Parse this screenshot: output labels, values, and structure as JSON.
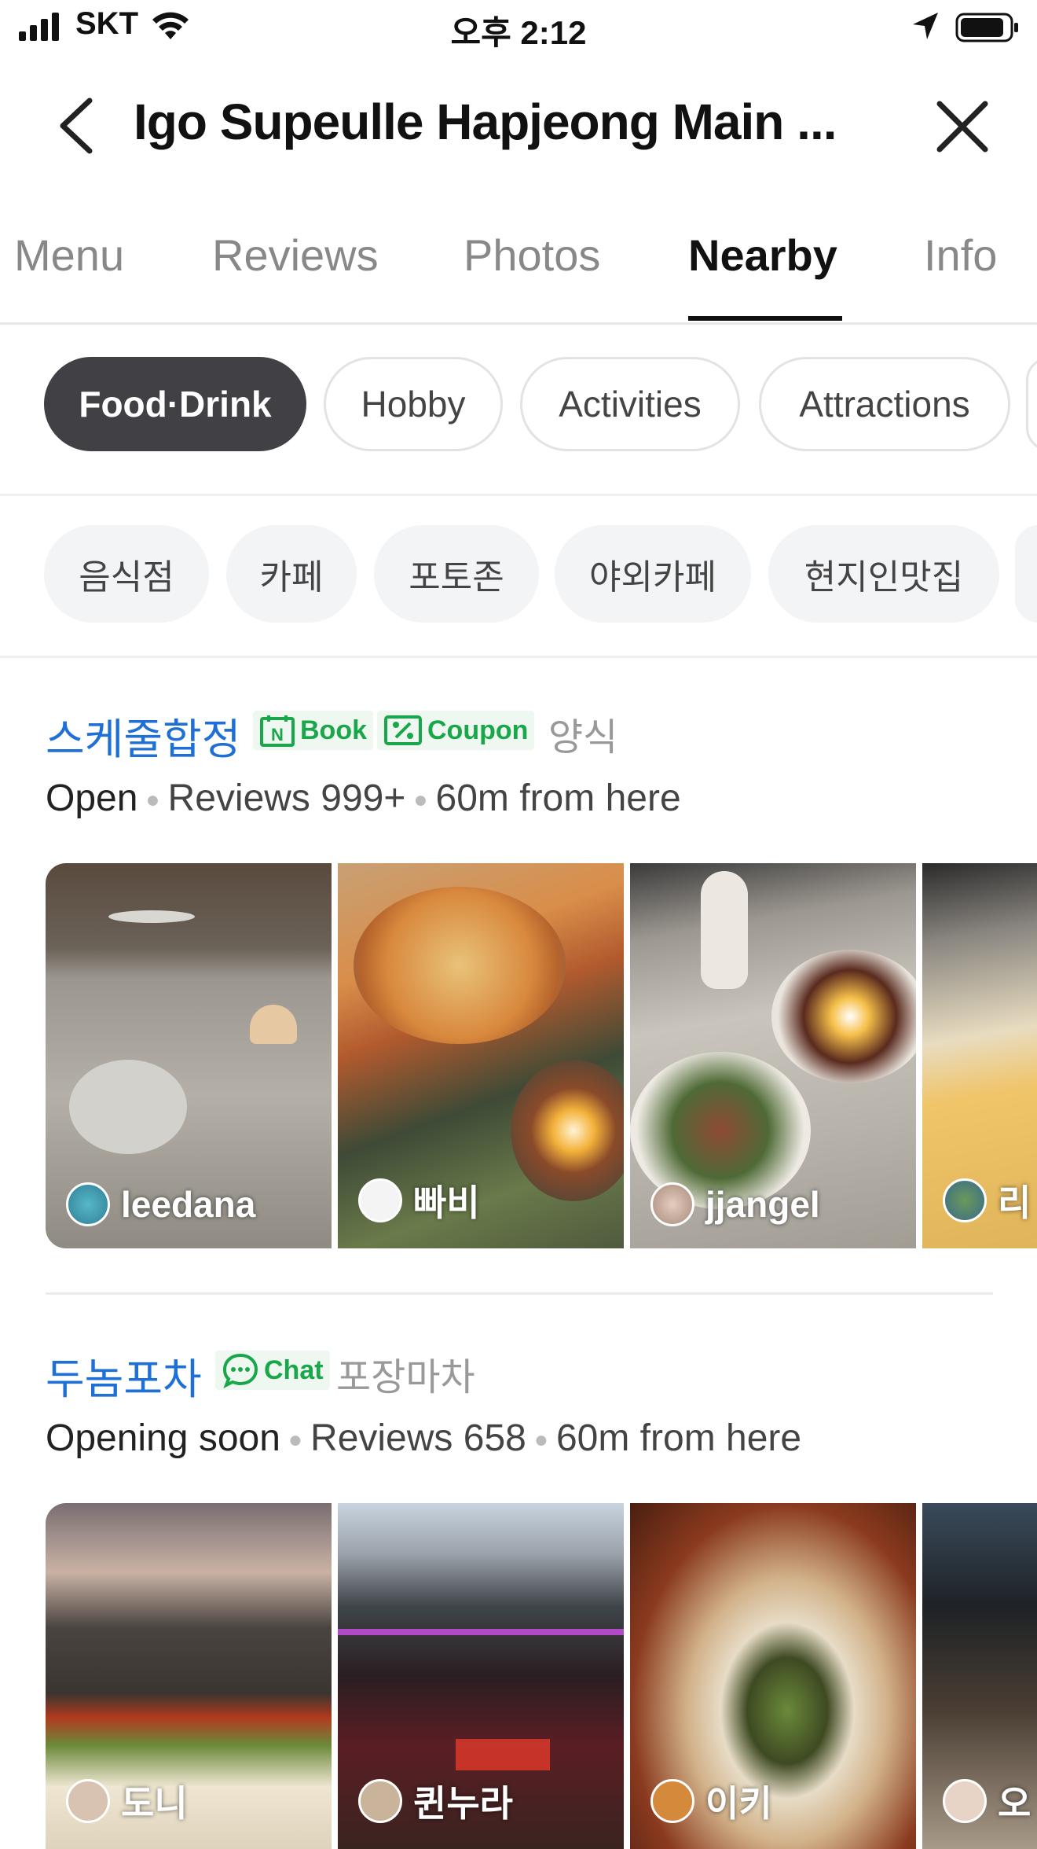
{
  "status_bar": {
    "carrier": "SKT",
    "time": "오후 2:12"
  },
  "header": {
    "title": "Igo Supeulle Hapjeong Main ..."
  },
  "tabs": [
    {
      "label": "Menu"
    },
    {
      "label": "Reviews"
    },
    {
      "label": "Photos"
    },
    {
      "label": "Nearby",
      "active": true
    },
    {
      "label": "Info"
    }
  ],
  "categories": [
    {
      "label": "Food·Drink",
      "active": true
    },
    {
      "label": "Hobby"
    },
    {
      "label": "Activities"
    },
    {
      "label": "Attractions"
    }
  ],
  "subcategories": [
    {
      "label": "음식점"
    },
    {
      "label": "카페"
    },
    {
      "label": "포토존"
    },
    {
      "label": "야외카페"
    },
    {
      "label": "현지인맛집"
    }
  ],
  "places": [
    {
      "name": "스케줄합정",
      "badges": [
        {
          "label": "Book",
          "icon": "naver-n-icon"
        },
        {
          "label": "Coupon",
          "icon": "percent-coupon-icon"
        }
      ],
      "category": "양식",
      "status": "Open",
      "reviews": "Reviews 999+",
      "distance": "60m from here",
      "photos": [
        {
          "user": "leedana"
        },
        {
          "user": "빠비"
        },
        {
          "user": "jjangel"
        },
        {
          "user": "리"
        }
      ]
    },
    {
      "name": "두놈포차",
      "badges": [
        {
          "label": "Chat",
          "icon": "chat-bubble-icon"
        }
      ],
      "category": "포장마차",
      "status": "Opening soon",
      "reviews": "Reviews 658",
      "distance": "60m from here",
      "photos": [
        {
          "user": "도니"
        },
        {
          "user": "퀸누라"
        },
        {
          "user": "이키"
        },
        {
          "user": "오"
        }
      ]
    }
  ],
  "colors": {
    "accent_text": "#1e6fd6",
    "badge_green": "#1aa64a",
    "active_chip": "#404045"
  }
}
